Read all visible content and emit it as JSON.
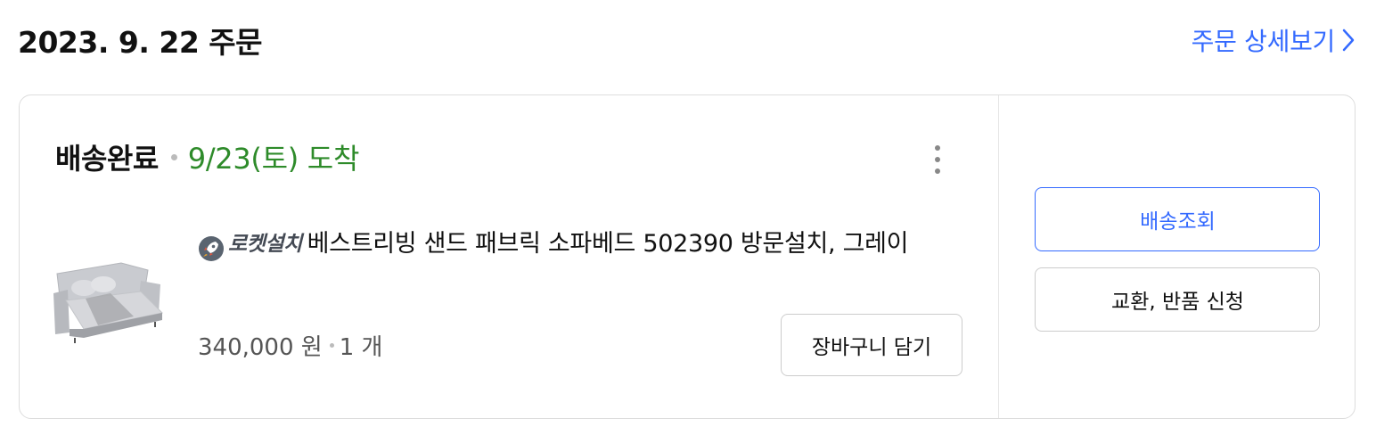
{
  "order": {
    "date_label": "2023. 9. 22 주문",
    "detail_link": "주문 상세보기"
  },
  "shipment": {
    "status": "배송완료",
    "arrival": "9/23(토) 도착"
  },
  "product": {
    "badge": "로켓설치",
    "name": "베스트리빙 샌드 패브릭 소파베드 502390 방문설치, 그레이",
    "price": "340,000 원",
    "quantity": "1 개",
    "cart_button": "장바구니 담기"
  },
  "actions": {
    "track_delivery": "배송조회",
    "exchange_return": "교환, 반품 신청"
  },
  "colors": {
    "accent": "#346aff",
    "arrival_green": "#2e8b2a"
  },
  "icons": {
    "detail_link": "chevron-right-icon",
    "badge": "rocket-icon",
    "menu": "more-vertical-icon"
  }
}
